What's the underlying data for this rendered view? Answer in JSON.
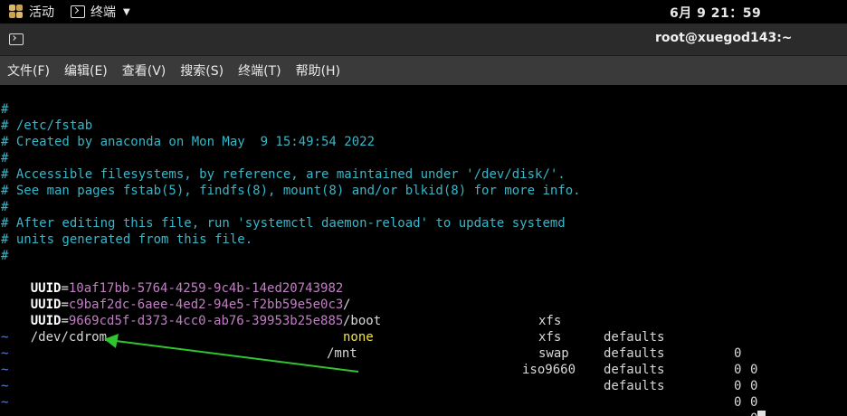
{
  "topbar": {
    "activities": "活动",
    "app_name": "终端",
    "clock": "6月 9  21：59"
  },
  "window": {
    "title": "root@xuegod143:~"
  },
  "menubar": {
    "items": [
      "文件(F)",
      "编辑(E)",
      "查看(V)",
      "搜索(S)",
      "终端(T)",
      "帮助(H)"
    ]
  },
  "terminal": {
    "comments": [
      "#",
      "# /etc/fstab",
      "# Created by anaconda on Mon May  9 15:49:54 2022",
      "#",
      "# Accessible filesystems, by reference, are maintained under '/dev/disk/'.",
      "# See man pages fstab(5), findfs(8), mount(8) and/or blkid(8) for more info.",
      "#",
      "# After editing this file, run 'systemctl daemon-reload' to update systemd",
      "# units generated from this file.",
      "#"
    ],
    "entries": [
      {
        "key": "UUID",
        "sep": "=",
        "id": "10af17bb-5764-4259-9c4b-14ed20743982",
        "mount": "/",
        "fs": "xfs",
        "opts": "defaults",
        "dump": "0",
        "pass": "0"
      },
      {
        "key": "UUID",
        "sep": "=",
        "id": "c9baf2dc-6aee-4ed2-94e5-f2bb59e5e0c3",
        "mount": "/boot",
        "fs": "xfs",
        "opts": "defaults",
        "dump": "0",
        "pass": "0"
      },
      {
        "key": "UUID",
        "sep": "=",
        "id": "9669cd5f-d373-4cc0-ab76-39953b25e885",
        "mount": "none",
        "fs": "swap",
        "opts": "defaults",
        "dump": "0",
        "pass": "0"
      },
      {
        "device": "/dev/cdrom",
        "mount": "/mnt",
        "fs": "iso9660",
        "opts": "defaults",
        "dump": "0",
        "pass": "0"
      }
    ],
    "tilde_lines": [
      "~",
      "~",
      "~",
      "~",
      "~"
    ]
  },
  "colors": {
    "comment": "#35b7c9",
    "uuid": "#c17fc4",
    "none_value": "#f1e04a",
    "tilde": "#5c7fd6",
    "annotation_arrow": "#2fc52f"
  }
}
